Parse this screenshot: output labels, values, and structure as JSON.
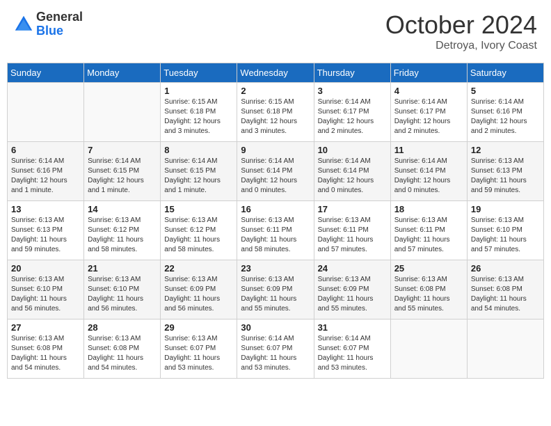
{
  "header": {
    "logo_general": "General",
    "logo_blue": "Blue",
    "month_title": "October 2024",
    "subtitle": "Detroya, Ivory Coast"
  },
  "days_of_week": [
    "Sunday",
    "Monday",
    "Tuesday",
    "Wednesday",
    "Thursday",
    "Friday",
    "Saturday"
  ],
  "weeks": [
    [
      {
        "day": "",
        "info": ""
      },
      {
        "day": "",
        "info": ""
      },
      {
        "day": "1",
        "sunrise": "Sunrise: 6:15 AM",
        "sunset": "Sunset: 6:18 PM",
        "daylight": "Daylight: 12 hours and 3 minutes."
      },
      {
        "day": "2",
        "sunrise": "Sunrise: 6:15 AM",
        "sunset": "Sunset: 6:18 PM",
        "daylight": "Daylight: 12 hours and 3 minutes."
      },
      {
        "day": "3",
        "sunrise": "Sunrise: 6:14 AM",
        "sunset": "Sunset: 6:17 PM",
        "daylight": "Daylight: 12 hours and 2 minutes."
      },
      {
        "day": "4",
        "sunrise": "Sunrise: 6:14 AM",
        "sunset": "Sunset: 6:17 PM",
        "daylight": "Daylight: 12 hours and 2 minutes."
      },
      {
        "day": "5",
        "sunrise": "Sunrise: 6:14 AM",
        "sunset": "Sunset: 6:16 PM",
        "daylight": "Daylight: 12 hours and 2 minutes."
      }
    ],
    [
      {
        "day": "6",
        "sunrise": "Sunrise: 6:14 AM",
        "sunset": "Sunset: 6:16 PM",
        "daylight": "Daylight: 12 hours and 1 minute."
      },
      {
        "day": "7",
        "sunrise": "Sunrise: 6:14 AM",
        "sunset": "Sunset: 6:15 PM",
        "daylight": "Daylight: 12 hours and 1 minute."
      },
      {
        "day": "8",
        "sunrise": "Sunrise: 6:14 AM",
        "sunset": "Sunset: 6:15 PM",
        "daylight": "Daylight: 12 hours and 1 minute."
      },
      {
        "day": "9",
        "sunrise": "Sunrise: 6:14 AM",
        "sunset": "Sunset: 6:14 PM",
        "daylight": "Daylight: 12 hours and 0 minutes."
      },
      {
        "day": "10",
        "sunrise": "Sunrise: 6:14 AM",
        "sunset": "Sunset: 6:14 PM",
        "daylight": "Daylight: 12 hours and 0 minutes."
      },
      {
        "day": "11",
        "sunrise": "Sunrise: 6:14 AM",
        "sunset": "Sunset: 6:14 PM",
        "daylight": "Daylight: 12 hours and 0 minutes."
      },
      {
        "day": "12",
        "sunrise": "Sunrise: 6:13 AM",
        "sunset": "Sunset: 6:13 PM",
        "daylight": "Daylight: 11 hours and 59 minutes."
      }
    ],
    [
      {
        "day": "13",
        "sunrise": "Sunrise: 6:13 AM",
        "sunset": "Sunset: 6:13 PM",
        "daylight": "Daylight: 11 hours and 59 minutes."
      },
      {
        "day": "14",
        "sunrise": "Sunrise: 6:13 AM",
        "sunset": "Sunset: 6:12 PM",
        "daylight": "Daylight: 11 hours and 58 minutes."
      },
      {
        "day": "15",
        "sunrise": "Sunrise: 6:13 AM",
        "sunset": "Sunset: 6:12 PM",
        "daylight": "Daylight: 11 hours and 58 minutes."
      },
      {
        "day": "16",
        "sunrise": "Sunrise: 6:13 AM",
        "sunset": "Sunset: 6:11 PM",
        "daylight": "Daylight: 11 hours and 58 minutes."
      },
      {
        "day": "17",
        "sunrise": "Sunrise: 6:13 AM",
        "sunset": "Sunset: 6:11 PM",
        "daylight": "Daylight: 11 hours and 57 minutes."
      },
      {
        "day": "18",
        "sunrise": "Sunrise: 6:13 AM",
        "sunset": "Sunset: 6:11 PM",
        "daylight": "Daylight: 11 hours and 57 minutes."
      },
      {
        "day": "19",
        "sunrise": "Sunrise: 6:13 AM",
        "sunset": "Sunset: 6:10 PM",
        "daylight": "Daylight: 11 hours and 57 minutes."
      }
    ],
    [
      {
        "day": "20",
        "sunrise": "Sunrise: 6:13 AM",
        "sunset": "Sunset: 6:10 PM",
        "daylight": "Daylight: 11 hours and 56 minutes."
      },
      {
        "day": "21",
        "sunrise": "Sunrise: 6:13 AM",
        "sunset": "Sunset: 6:10 PM",
        "daylight": "Daylight: 11 hours and 56 minutes."
      },
      {
        "day": "22",
        "sunrise": "Sunrise: 6:13 AM",
        "sunset": "Sunset: 6:09 PM",
        "daylight": "Daylight: 11 hours and 56 minutes."
      },
      {
        "day": "23",
        "sunrise": "Sunrise: 6:13 AM",
        "sunset": "Sunset: 6:09 PM",
        "daylight": "Daylight: 11 hours and 55 minutes."
      },
      {
        "day": "24",
        "sunrise": "Sunrise: 6:13 AM",
        "sunset": "Sunset: 6:09 PM",
        "daylight": "Daylight: 11 hours and 55 minutes."
      },
      {
        "day": "25",
        "sunrise": "Sunrise: 6:13 AM",
        "sunset": "Sunset: 6:08 PM",
        "daylight": "Daylight: 11 hours and 55 minutes."
      },
      {
        "day": "26",
        "sunrise": "Sunrise: 6:13 AM",
        "sunset": "Sunset: 6:08 PM",
        "daylight": "Daylight: 11 hours and 54 minutes."
      }
    ],
    [
      {
        "day": "27",
        "sunrise": "Sunrise: 6:13 AM",
        "sunset": "Sunset: 6:08 PM",
        "daylight": "Daylight: 11 hours and 54 minutes."
      },
      {
        "day": "28",
        "sunrise": "Sunrise: 6:13 AM",
        "sunset": "Sunset: 6:08 PM",
        "daylight": "Daylight: 11 hours and 54 minutes."
      },
      {
        "day": "29",
        "sunrise": "Sunrise: 6:13 AM",
        "sunset": "Sunset: 6:07 PM",
        "daylight": "Daylight: 11 hours and 53 minutes."
      },
      {
        "day": "30",
        "sunrise": "Sunrise: 6:14 AM",
        "sunset": "Sunset: 6:07 PM",
        "daylight": "Daylight: 11 hours and 53 minutes."
      },
      {
        "day": "31",
        "sunrise": "Sunrise: 6:14 AM",
        "sunset": "Sunset: 6:07 PM",
        "daylight": "Daylight: 11 hours and 53 minutes."
      },
      {
        "day": "",
        "info": ""
      },
      {
        "day": "",
        "info": ""
      }
    ]
  ]
}
